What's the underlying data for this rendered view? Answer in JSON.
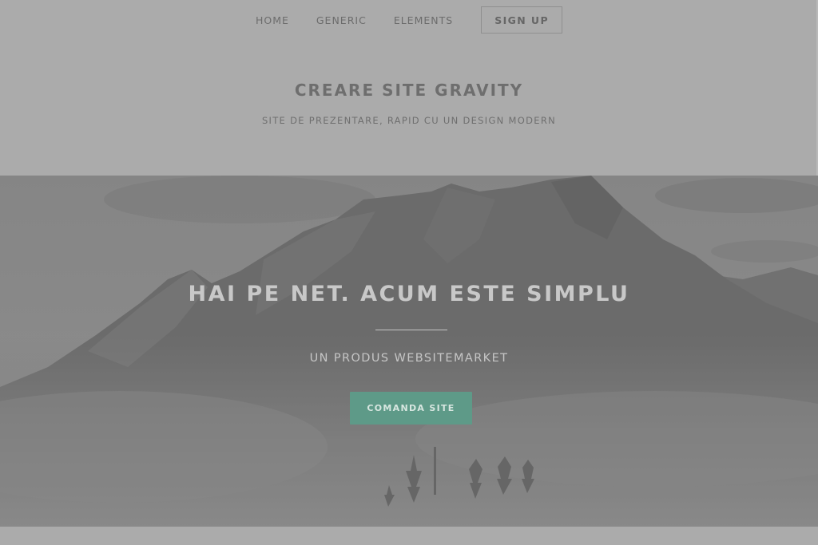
{
  "nav": {
    "items": [
      {
        "label": "HOME"
      },
      {
        "label": "GENERIC"
      },
      {
        "label": "ELEMENTS"
      }
    ],
    "signup_label": "SIGN UP"
  },
  "header": {
    "title": "CREARE SITE GRAVITY",
    "subtitle": "SITE DE PREZENTARE, RAPID CU UN DESIGN MODERN"
  },
  "hero": {
    "title": "HAI PE NET. ACUM ESTE SIMPLU",
    "subtitle": "UN PRODUS WEBSITEMARKET",
    "cta_label": "COMANDA SITE",
    "background": "mountain-image"
  },
  "colors": {
    "page_bg": "#ababab",
    "accent_button": "#5e9a88"
  }
}
